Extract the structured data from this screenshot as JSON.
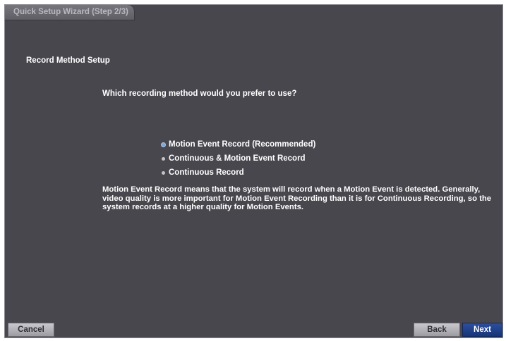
{
  "window": {
    "title": "Quick Setup Wizard (Step 2/3)"
  },
  "section": {
    "heading": "Record Method Setup"
  },
  "question": "Which recording method would you prefer to use?",
  "options": [
    {
      "label": "Motion Event Record (Recommended)",
      "selected": true
    },
    {
      "label": "Continuous & Motion Event Record",
      "selected": false
    },
    {
      "label": "Continuous Record",
      "selected": false
    }
  ],
  "description": "Motion Event Record means that the system will record when a Motion Event is detected. Generally, video quality is more important for Motion Event Recording than it is for Continuous Recording, so the system records at a higher quality for Motion Events.",
  "buttons": {
    "cancel": "Cancel",
    "back": "Back",
    "next": "Next"
  },
  "colors": {
    "background": "#48474e",
    "selected_bullet": "#7fa6d8",
    "next_button": "#1f3f8a"
  }
}
